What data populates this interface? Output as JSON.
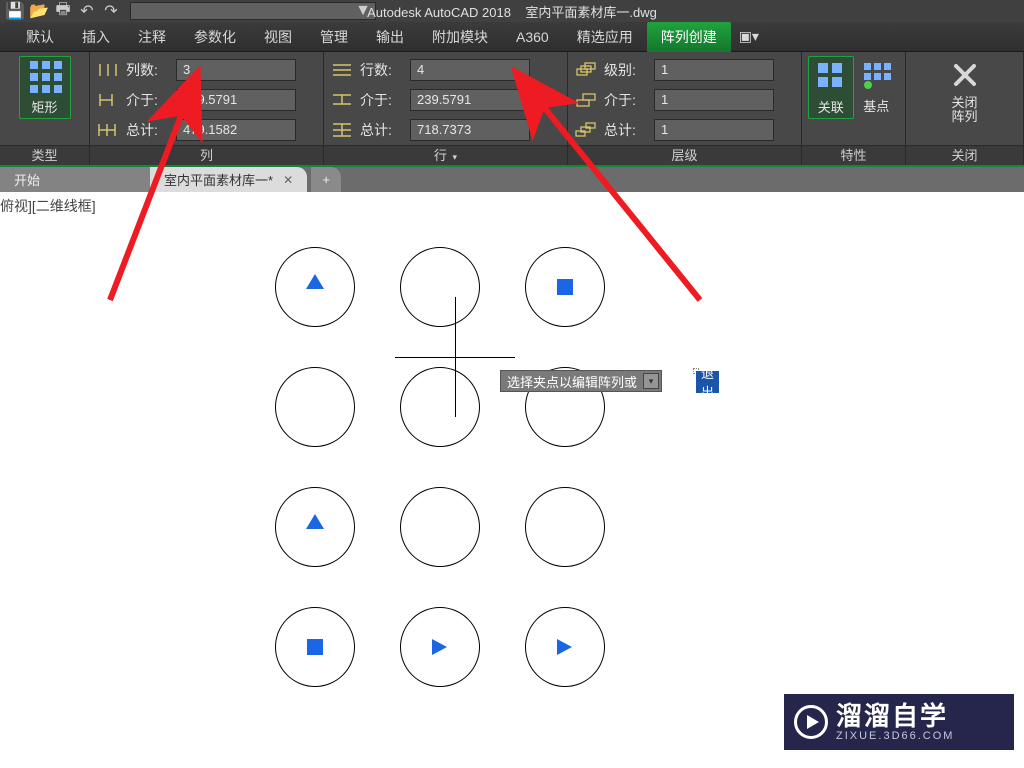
{
  "colors": {
    "brand_green": "#14772d",
    "accent_blue": "#1a66e6",
    "arrow_red": "#ee1b22"
  },
  "title": {
    "app": "Autodesk AutoCAD 2018",
    "file": "室内平面素材库一.dwg"
  },
  "menu": {
    "items": [
      {
        "label": "默认"
      },
      {
        "label": "插入"
      },
      {
        "label": "注释"
      },
      {
        "label": "参数化"
      },
      {
        "label": "视图"
      },
      {
        "label": "管理"
      },
      {
        "label": "输出"
      },
      {
        "label": "附加模块"
      },
      {
        "label": "A360"
      },
      {
        "label": "精选应用"
      },
      {
        "label": "阵列创建",
        "active": true
      }
    ]
  },
  "ribbon": {
    "type_panel": {
      "label": "类型",
      "rect_btn": "矩形"
    },
    "cols_panel": {
      "label": "列",
      "rows": [
        {
          "label": "列数:",
          "value": "3"
        },
        {
          "label": "介于:",
          "value": "239.5791"
        },
        {
          "label": "总计:",
          "value": "479.1582"
        }
      ]
    },
    "rows_panel": {
      "label": "行",
      "dropdown": "▾",
      "rows": [
        {
          "label": "行数:",
          "value": "4"
        },
        {
          "label": "介于:",
          "value": "239.5791"
        },
        {
          "label": "总计:",
          "value": "718.7373"
        }
      ]
    },
    "levels_panel": {
      "label": "层级",
      "rows": [
        {
          "label": "级别:",
          "value": "1"
        },
        {
          "label": "介于:",
          "value": "1"
        },
        {
          "label": "总计:",
          "value": "1"
        }
      ]
    },
    "props_panel": {
      "label": "特性",
      "assoc_btn": "关联",
      "base_btn": "基点"
    },
    "close_panel": {
      "label": "关闭",
      "close_btn": "关闭\n阵列"
    }
  },
  "doctabs": {
    "start": "开始",
    "active": "室内平面素材库一*",
    "plus": "+"
  },
  "viewport": {
    "label": "俯视][二维线框]"
  },
  "tooltip": {
    "text": "选择夹点以编辑阵列或",
    "exit": "退出"
  },
  "watermark": {
    "brand": "溜溜自学",
    "url": "ZIXUE.3D66.COM"
  }
}
